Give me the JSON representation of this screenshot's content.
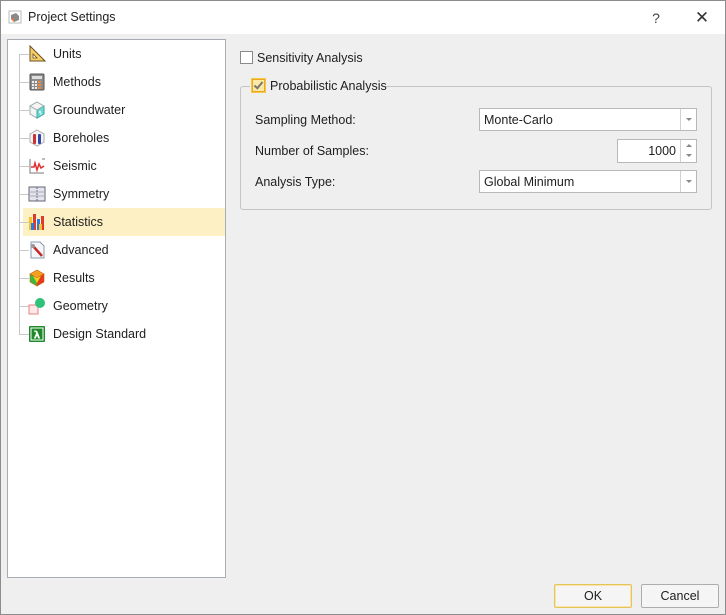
{
  "window": {
    "title": "Project Settings",
    "help_label": "?",
    "close_label": "✕",
    "app_icon": "project-settings-icon"
  },
  "sidebar": {
    "selected": "Statistics",
    "items": [
      {
        "label": "Units",
        "icon": "triangle-ruler-icon"
      },
      {
        "label": "Methods",
        "icon": "calculator-icon"
      },
      {
        "label": "Groundwater",
        "icon": "water-cube-icon"
      },
      {
        "label": "Boreholes",
        "icon": "borehole-icon"
      },
      {
        "label": "Seismic",
        "icon": "seismic-wave-icon"
      },
      {
        "label": "Symmetry",
        "icon": "symmetry-icon"
      },
      {
        "label": "Statistics",
        "icon": "bar-chart-icon"
      },
      {
        "label": "Advanced",
        "icon": "wrench-document-icon"
      },
      {
        "label": "Results",
        "icon": "results-cube-icon"
      },
      {
        "label": "Geometry",
        "icon": "geometry-shapes-icon"
      },
      {
        "label": "Design Standard",
        "icon": "lambda-icon"
      }
    ]
  },
  "main": {
    "sensitivity": {
      "label": "Sensitivity Analysis",
      "checked": false
    },
    "probabilistic": {
      "label": "Probabilistic Analysis",
      "checked": true,
      "sampling_method": {
        "label": "Sampling Method:",
        "value": "Monte-Carlo"
      },
      "number_of_samples": {
        "label": "Number of Samples:",
        "value": "1000"
      },
      "analysis_type": {
        "label": "Analysis Type:",
        "value": "Global Minimum"
      }
    }
  },
  "footer": {
    "ok_label": "OK",
    "cancel_label": "Cancel"
  },
  "colors": {
    "selection_bg": "#fcf0c4",
    "checkbox_accent": "#e8a820"
  }
}
